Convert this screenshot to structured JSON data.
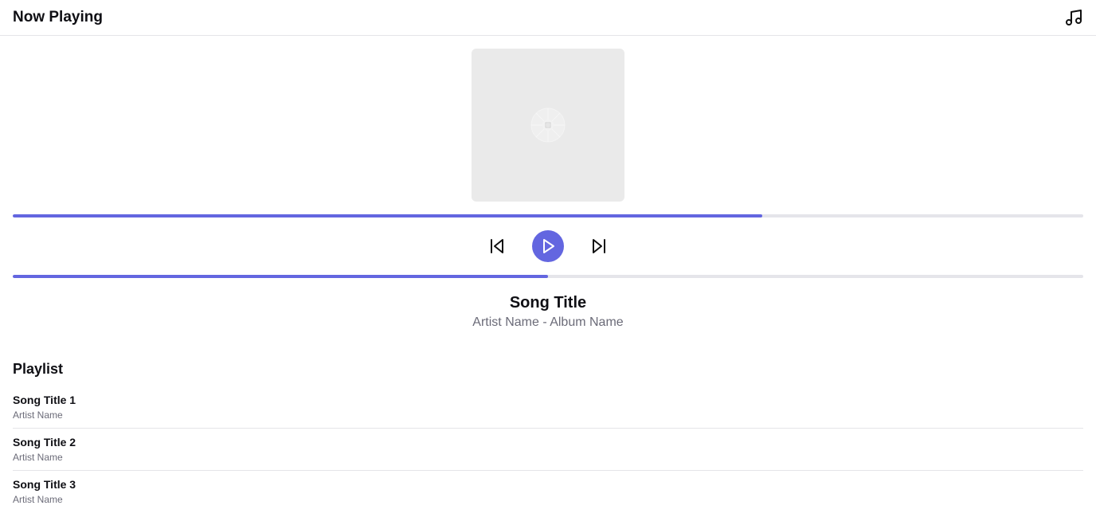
{
  "header": {
    "title": "Now Playing",
    "icon": "music-note-icon"
  },
  "album_art": {
    "icon": "vinyl-placeholder-icon"
  },
  "playback": {
    "buffer_fraction": 0.7,
    "progress_fraction": 0.5,
    "controls": {
      "prev_icon": "skip-back-icon",
      "play_icon": "play-icon",
      "next_icon": "skip-forward-icon"
    }
  },
  "now_playing": {
    "title": "Song Title",
    "subtitle": "Artist Name - Album Name"
  },
  "playlist": {
    "heading": "Playlist",
    "items": [
      {
        "title": "Song Title 1",
        "artist": "Artist Name"
      },
      {
        "title": "Song Title 2",
        "artist": "Artist Name"
      },
      {
        "title": "Song Title 3",
        "artist": "Artist Name"
      }
    ]
  },
  "colors": {
    "accent": "#6366e0",
    "track": "#e5e5ea",
    "muted_text": "#6b6b78",
    "art_background": "#eaeaea"
  }
}
